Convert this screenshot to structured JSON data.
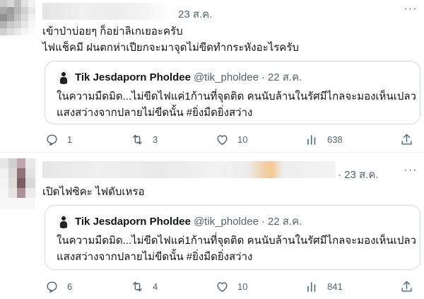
{
  "tweets": [
    {
      "date": "23 ส.ค.",
      "more_glyph": "···",
      "text_lines": [
        "เข้าป่าบ่อยๆ ก็อย่าลิเกเยอะครับ",
        "ไฟแช็คมี ฝนตกห่าเปียกจะมาจุดไม่ขีดทำกระหังอะไรครับ"
      ],
      "quote": {
        "name": "Tik Jesdaporn Pholdee",
        "handle": "@tik_pholdee",
        "separator": "·",
        "date": "22 ส.ค.",
        "text_lines": [
          "ในความมืดมิด...ไม่ขีดไฟแค่1ก้านที่จุดติด คนนับล้านในรัศมีไกลจะมองเห็นเปลว",
          "แสงสว่างจากปลายไม่ขีดนั้น #ยิ่งมืดยิ่งสว่าง"
        ]
      },
      "actions": {
        "replies": "1",
        "retweets": "3",
        "likes": "10",
        "views": "638"
      }
    },
    {
      "date": "· 23 ส.ค.",
      "more_glyph": "···",
      "text_lines": [
        "เปิดไฟซิคะ ไฟดับเหรอ"
      ],
      "quote": {
        "name": "Tik Jesdaporn Pholdee",
        "handle": "@tik_pholdee",
        "separator": "·",
        "date": "22 ส.ค.",
        "text_lines": [
          "ในความมืดมิด...ไม่ขีดไฟแค่1ก้านที่จุดติด คนนับล้านในรัศมีไกลจะมองเห็นเปลว",
          "แสงสว่างจากปลายไม่ขีดนั้น #ยิ่งมืดยิ่งสว่าง"
        ]
      },
      "actions": {
        "replies": "6",
        "retweets": "4",
        "likes": "10",
        "views": "841"
      }
    }
  ],
  "icons": {
    "reply": "reply-icon",
    "retweet": "retweet-icon",
    "like": "heart-icon",
    "views": "views-icon",
    "share": "share-icon"
  },
  "colors": {
    "text": "#0f1419",
    "secondary": "#536471",
    "border": "#cfd9de",
    "divider": "#eff3f4"
  }
}
